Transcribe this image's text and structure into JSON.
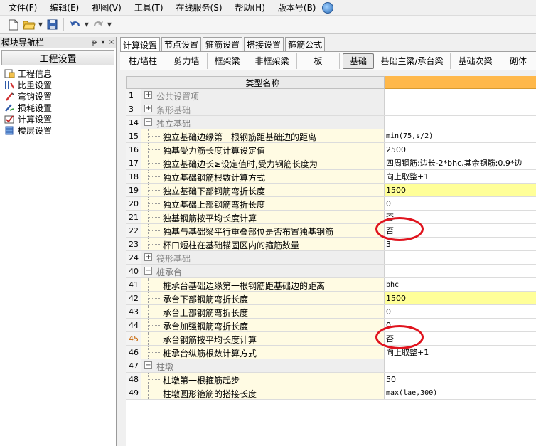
{
  "menu": [
    "文件(F)",
    "编辑(E)",
    "视图(V)",
    "工具(T)",
    "在线服务(S)",
    "帮助(H)",
    "版本号(B)"
  ],
  "nav": {
    "title": "模块导航栏",
    "pin_glyph": "ᵽ",
    "dropdown_glyph": "▾",
    "close_glyph": "×",
    "section": "工程设置",
    "items": [
      "工程信息",
      "比重设置",
      "弯钩设置",
      "损耗设置",
      "计算设置",
      "楼层设置"
    ]
  },
  "top_tabs": [
    "计算设置",
    "节点设置",
    "箍筋设置",
    "搭接设置",
    "箍筋公式"
  ],
  "sub_tabs": [
    "柱/墙柱",
    "剪力墙",
    "框架梁",
    "非框架梁",
    "板",
    "基础",
    "基础主梁/承台梁",
    "基础次梁",
    "砌体"
  ],
  "grid": {
    "header": "类型名称",
    "rows": [
      {
        "num": "1",
        "type": "cat",
        "exp": "+",
        "name": "公共设置项",
        "value": ""
      },
      {
        "num": "3",
        "type": "cat",
        "exp": "+",
        "name": "条形基础",
        "value": ""
      },
      {
        "num": "14",
        "type": "cat",
        "exp": "−",
        "name": "独立基础",
        "value": ""
      },
      {
        "num": "15",
        "type": "item",
        "name": "独立基础边缘第一根钢筋距基础边的距离",
        "value": "min(75,s/2)",
        "mono": true
      },
      {
        "num": "16",
        "type": "item",
        "name": "独基受力筋长度计算设定值",
        "value": "2500"
      },
      {
        "num": "17",
        "type": "item",
        "name": "独立基础边长≥设定值时,受力钢筋长度为",
        "value": "四周钢筋:边长-2*bhc,其余钢筋:0.9*边"
      },
      {
        "num": "18",
        "type": "item",
        "name": "独立基础钢筋根数计算方式",
        "value": "向上取整+1"
      },
      {
        "num": "19",
        "type": "item",
        "name": "独立基础下部钢筋弯折长度",
        "value": "1500",
        "highlight": true
      },
      {
        "num": "20",
        "type": "item",
        "name": "独立基础上部钢筋弯折长度",
        "value": "0"
      },
      {
        "num": "21",
        "type": "item",
        "name": "独基钢筋按平均长度计算",
        "value": "否"
      },
      {
        "num": "22",
        "type": "item",
        "name": "独基与基础梁平行重叠部位是否布置独基钢筋",
        "value": "否"
      },
      {
        "num": "23",
        "type": "item",
        "name": "杯口短柱在基础锚固区内的箍筋数量",
        "value": "3"
      },
      {
        "num": "24",
        "type": "cat",
        "exp": "+",
        "name": "筏形基础",
        "value": ""
      },
      {
        "num": "40",
        "type": "cat",
        "exp": "−",
        "name": "桩承台",
        "value": ""
      },
      {
        "num": "41",
        "type": "item",
        "name": "桩承台基础边缘第一根钢筋距基础边的距离",
        "value": "bhc",
        "mono": true
      },
      {
        "num": "42",
        "type": "item",
        "name": "承台下部钢筋弯折长度",
        "value": "1500",
        "highlight": true
      },
      {
        "num": "43",
        "type": "item",
        "name": "承台上部钢筋弯折长度",
        "value": "0"
      },
      {
        "num": "44",
        "type": "item",
        "name": "承台加强钢筋弯折长度",
        "value": "0"
      },
      {
        "num": "45",
        "type": "item",
        "name": "承台钢筋按平均长度计算",
        "value": "否",
        "orange": true
      },
      {
        "num": "46",
        "type": "item",
        "name": "桩承台纵筋根数计算方式",
        "value": "向上取整+1"
      },
      {
        "num": "47",
        "type": "cat",
        "exp": "−",
        "name": "柱墩",
        "value": ""
      },
      {
        "num": "48",
        "type": "item",
        "name": "柱墩第一根箍筋起步",
        "value": "50"
      },
      {
        "num": "49",
        "type": "item",
        "name": "柱墩圆形箍筋的搭接长度",
        "value": "max(lae,300)",
        "mono": true
      }
    ]
  }
}
